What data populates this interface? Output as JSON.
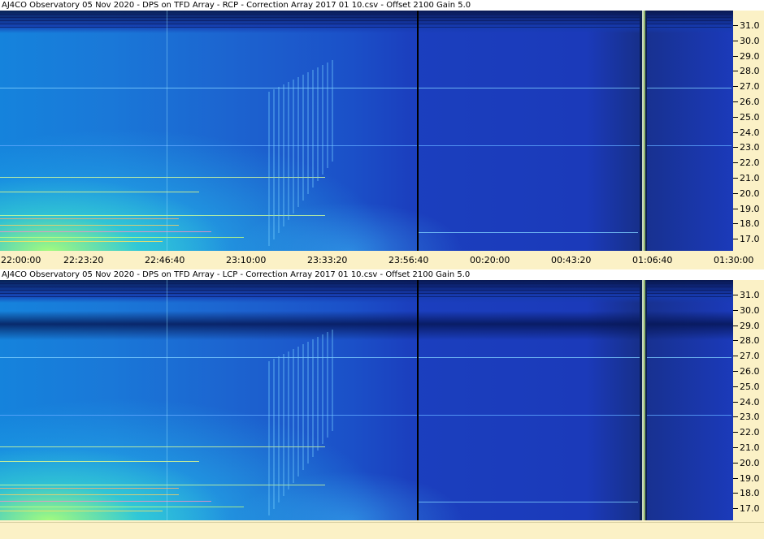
{
  "colors": {
    "panel_bg": "#fbf1c6",
    "spectrum_base": "#1a3fbf",
    "data_gap_marker": "#000000"
  },
  "panels": [
    {
      "title": "AJ4CO Observatory 05 Nov 2020  -  DPS on TFD Array  -  RCP  -  Correction Array 2017 01 10.csv  -  Offset 2100  Gain 5.0",
      "y_labels": [
        "31.0",
        "30.0",
        "29.0",
        "28.0",
        "27.0",
        "26.0",
        "25.0",
        "24.0",
        "23.0",
        "22.0",
        "21.0",
        "20.0",
        "19.0",
        "18.0",
        "17.0"
      ]
    },
    {
      "title": "AJ4CO Observatory 05 Nov 2020  -  DPS on TFD Array  -  LCP  -  Correction Array 2017 01 10.csv  -  Offset 2100  Gain 5.0",
      "y_labels": [
        "31.0",
        "30.0",
        "29.0",
        "28.0",
        "27.0",
        "26.0",
        "25.0",
        "24.0",
        "23.0",
        "22.0",
        "21.0",
        "20.0",
        "19.0",
        "18.0",
        "17.0"
      ]
    }
  ],
  "x_labels": [
    "22:00:00",
    "22:23:20",
    "22:46:40",
    "23:10:00",
    "23:33:20",
    "23:56:40",
    "00:20:00",
    "00:43:20",
    "01:06:40",
    "01:30:00"
  ]
}
